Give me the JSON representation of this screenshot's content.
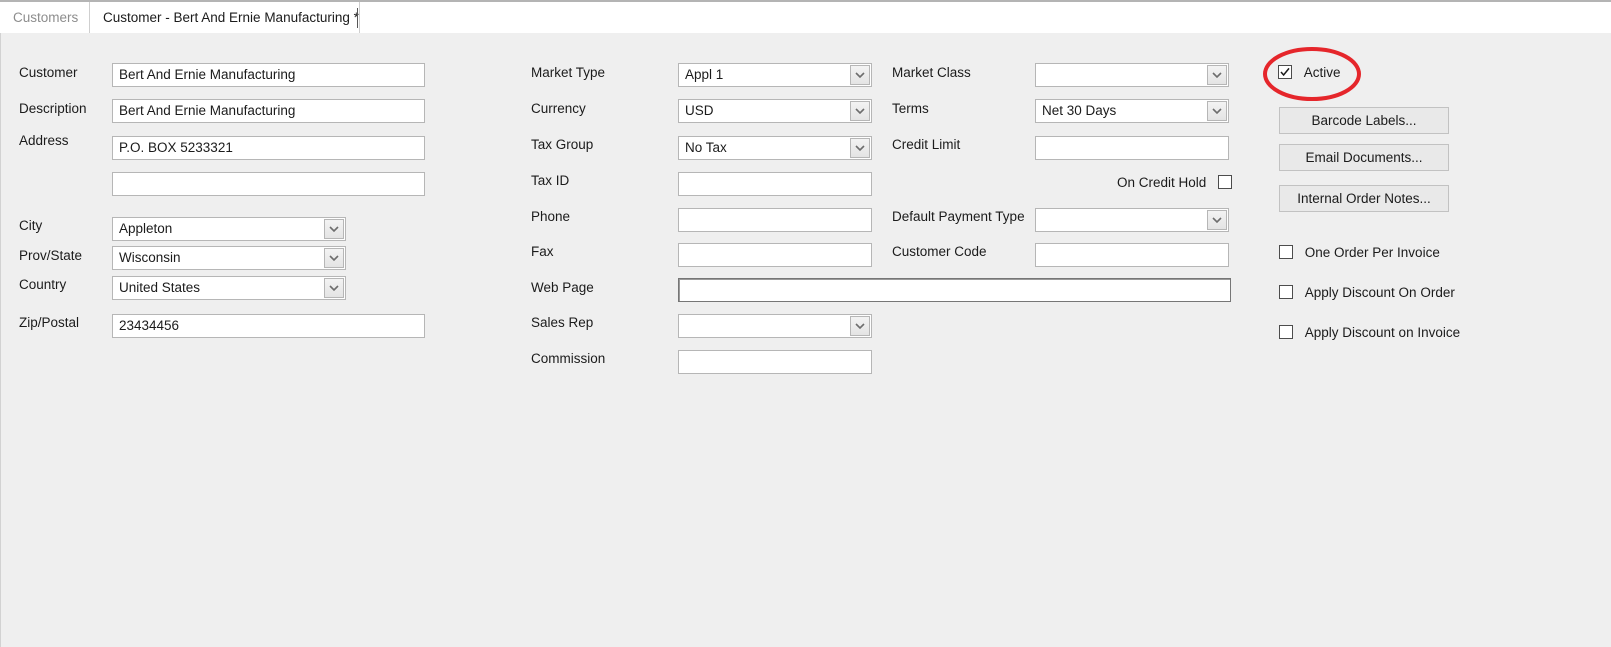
{
  "window": {
    "background_color": "#efefef",
    "tabstrip_background": "#ffffff"
  },
  "tabs": [
    {
      "label": "Customers",
      "active": false
    },
    {
      "label": "Customer - Bert And Ernie Manufacturing *",
      "active": true
    }
  ],
  "form": {
    "column_left": {
      "customer": {
        "label": "Customer",
        "value": "Bert And Ernie Manufacturing"
      },
      "description": {
        "label": "Description",
        "value": "Bert And Ernie Manufacturing"
      },
      "address": {
        "label": "Address",
        "value": "P.O. BOX 5233321"
      },
      "address2": {
        "label": "",
        "value": ""
      },
      "city": {
        "label": "City",
        "value": "Appleton"
      },
      "prov_state": {
        "label": "Prov/State",
        "value": "Wisconsin"
      },
      "country": {
        "label": "Country",
        "value": "United States"
      },
      "zip_postal": {
        "label": "Zip/Postal",
        "value": "23434456"
      }
    },
    "column_middle": {
      "market_type": {
        "label": "Market Type",
        "value": "Appl 1"
      },
      "currency": {
        "label": "Currency",
        "value": "USD"
      },
      "tax_group": {
        "label": "Tax Group",
        "value": "No Tax"
      },
      "tax_id": {
        "label": "Tax ID",
        "value": ""
      },
      "phone": {
        "label": "Phone",
        "value": ""
      },
      "fax": {
        "label": "Fax",
        "value": ""
      },
      "web_page": {
        "label": "Web Page",
        "value": "",
        "focused": true
      },
      "sales_rep": {
        "label": "Sales Rep",
        "value": ""
      },
      "commission": {
        "label": "Commission",
        "value": ""
      }
    },
    "column_right": {
      "market_class": {
        "label": "Market Class",
        "value": ""
      },
      "terms": {
        "label": "Terms",
        "value": "Net 30 Days"
      },
      "credit_limit": {
        "label": "Credit Limit",
        "value": ""
      },
      "on_credit_hold": {
        "label": "On Credit Hold",
        "checked": false
      },
      "default_payment_type": {
        "label": "Default Payment Type",
        "value": ""
      },
      "customer_code": {
        "label": "Customer Code",
        "value": ""
      }
    }
  },
  "side_panel": {
    "active_checkbox": {
      "label": "Active",
      "checked": true
    },
    "buttons": [
      {
        "label": "Barcode Labels..."
      },
      {
        "label": "Email Documents..."
      },
      {
        "label": "Internal Order Notes..."
      }
    ],
    "options": [
      {
        "label": "One Order Per Invoice",
        "checked": false
      },
      {
        "label": "Apply Discount On Order",
        "checked": false
      },
      {
        "label": "Apply Discount on Invoice",
        "checked": false
      }
    ]
  },
  "annotation": {
    "type": "ellipse-highlight",
    "target": "Active",
    "color": "#e5262b"
  }
}
